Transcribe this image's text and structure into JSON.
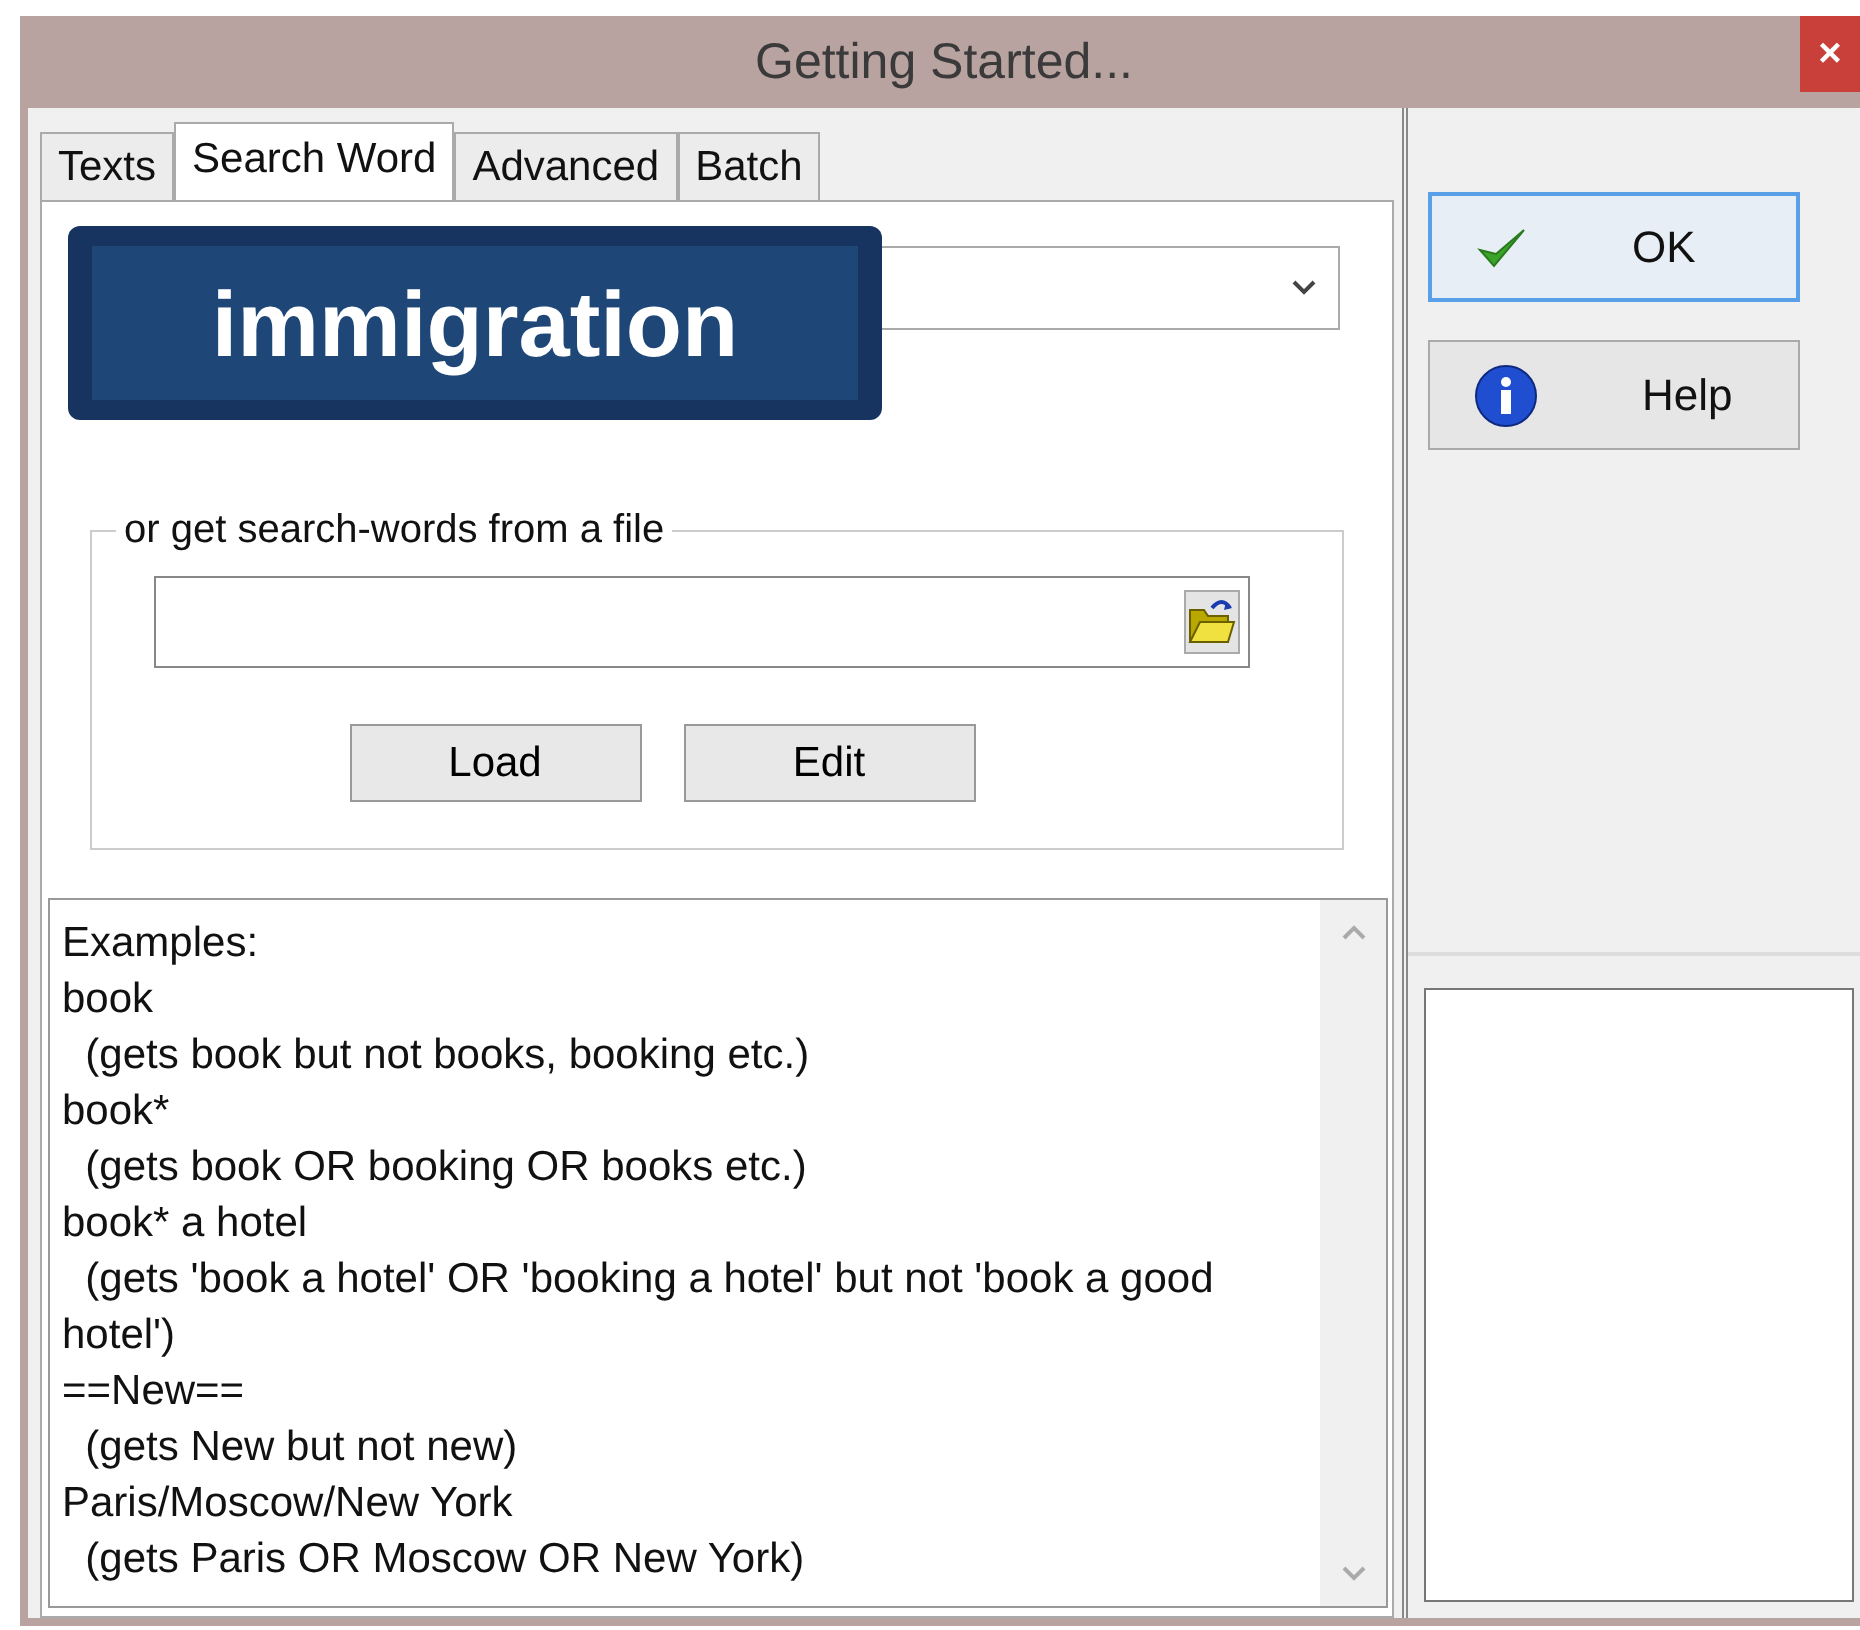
{
  "window": {
    "title": "Getting Started...",
    "close": "×"
  },
  "tabs": [
    {
      "label": "Texts",
      "selected": false
    },
    {
      "label": "Search Word",
      "selected": true
    },
    {
      "label": "Advanced",
      "selected": false
    },
    {
      "label": "Batch",
      "selected": false
    }
  ],
  "callout": {
    "text": "immigration"
  },
  "file_group": {
    "legend": "or get search-words from a file",
    "buttons": [
      "Load",
      "Edit"
    ]
  },
  "examples": [
    "Examples:",
    "book",
    "  (gets book but not books, booking etc.)",
    "book*",
    "  (gets book OR booking OR books etc.)",
    "book* a hotel",
    "  (gets 'book a hotel' OR 'booking a hotel' but not 'book a good hotel')",
    "==New==",
    "  (gets New but not new)",
    "Paris/Moscow/New York",
    "  (gets Paris OR Moscow OR New York)"
  ],
  "side_buttons": [
    {
      "kind": "ok",
      "label": "OK"
    },
    {
      "kind": "help",
      "label": "Help"
    }
  ]
}
